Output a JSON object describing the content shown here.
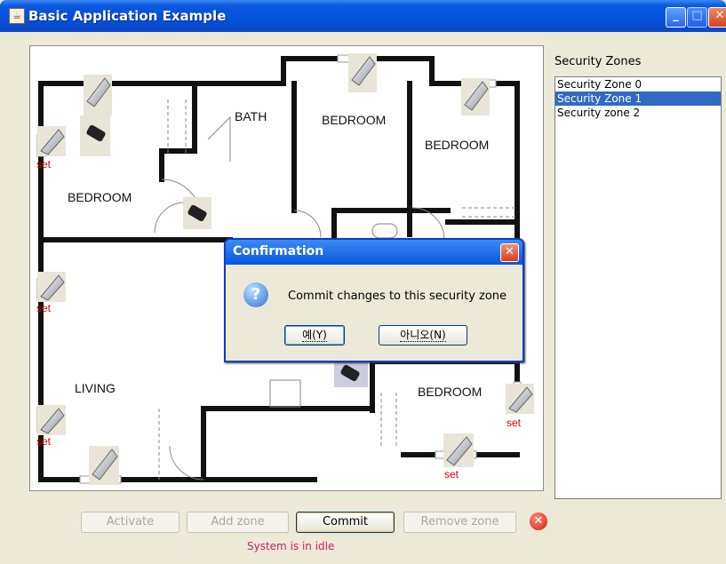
{
  "window": {
    "title": "Basic Application Example",
    "min_glyph": "_",
    "max_glyph": "□",
    "close_glyph": "✕"
  },
  "floorplan": {
    "rooms": [
      "BATH",
      "BEDROOM",
      "BEDROOM",
      "BEDROOM",
      "LIVING",
      "BEDROOM"
    ],
    "set_label": "set"
  },
  "zones": {
    "label": "Security Zones",
    "items": [
      {
        "label": "Security Zone 0",
        "selected": false
      },
      {
        "label": "Security Zone 1",
        "selected": true
      },
      {
        "label": "Security zone 2",
        "selected": false
      }
    ]
  },
  "toolbar": {
    "activate": "Activate",
    "add_zone": "Add zone",
    "commit": "Commit",
    "remove_zone": "Remove zone",
    "error_glyph": "✕"
  },
  "status": "System is in idle",
  "dialog": {
    "title": "Confirmation",
    "close_glyph": "✕",
    "question_glyph": "?",
    "message": "Commit changes to this security zone",
    "yes": "예(Y)",
    "no": "아니오(N)"
  }
}
